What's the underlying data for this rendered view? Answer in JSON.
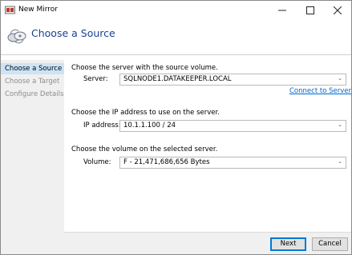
{
  "window": {
    "title": "New Mirror",
    "controls": {
      "minimize": "—",
      "maximize": "☐",
      "close": "✕"
    }
  },
  "header": {
    "title": "Choose a Source",
    "icon": "mirror-wizard-icon"
  },
  "sidebar": {
    "items": [
      {
        "label": "Choose a Source",
        "state": "active"
      },
      {
        "label": "Choose a Target",
        "state": "disabled"
      },
      {
        "label": "Configure Details",
        "state": "disabled"
      }
    ]
  },
  "server_section": {
    "prompt": "Choose the server with the source volume.",
    "label": "Server:",
    "value": "SQLNODE1.DATAKEEPER.LOCAL",
    "connect_link": "Connect to Server"
  },
  "ip_section": {
    "prompt": "Choose the IP address to use on the server.",
    "label": "IP address:",
    "value": "10.1.1.100 / 24"
  },
  "volume_section": {
    "prompt": "Choose the volume on the selected server.",
    "label": "Volume:",
    "value": "F - 21,471,686,656 Bytes"
  },
  "footer": {
    "next_label": "Next",
    "cancel_label": "Cancel"
  },
  "colors": {
    "accent": "#1c3f94",
    "selection": "#cce4f7",
    "link": "#0066cc"
  }
}
